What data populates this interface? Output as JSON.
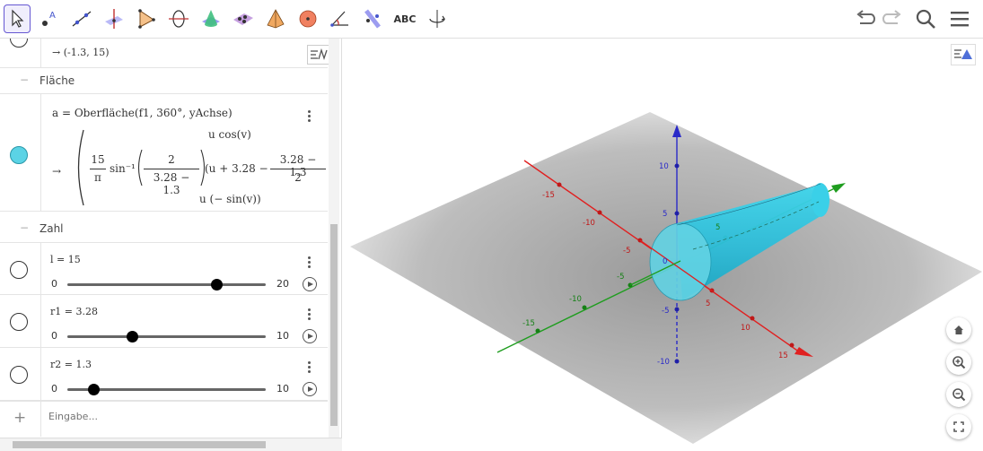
{
  "toolbar": {
    "tools": [
      {
        "name": "move-tool-icon"
      },
      {
        "name": "point-tool-icon"
      },
      {
        "name": "line-tool-icon"
      },
      {
        "name": "perpendicular-tool-icon"
      },
      {
        "name": "polygon-tool-icon"
      },
      {
        "name": "circle-axis-tool-icon"
      },
      {
        "name": "intersect-surfaces-tool-icon"
      },
      {
        "name": "plane-tool-icon"
      },
      {
        "name": "pyramid-tool-icon"
      },
      {
        "name": "sphere-tool-icon"
      },
      {
        "name": "angle-tool-icon"
      },
      {
        "name": "reflect-tool-icon"
      },
      {
        "name": "text-tool-icon"
      },
      {
        "name": "rotate-view-tool-icon"
      }
    ],
    "text_tool_label": "ABC"
  },
  "algebra": {
    "prev_output": "→  (-1.3, 15)",
    "group_surface": "Fläche",
    "surface_def": "a  =  Oberfläche(f1, 360°, yAchse)",
    "surface_output": {
      "arrow": "→",
      "frac15_num": "15",
      "frac15_den": "π",
      "asin": "sin⁻¹",
      "frac2_num": "2",
      "frac2_den": "3.28 − 1.3",
      "top_line": "u  cos(v)",
      "mid_line": "(u + 3.28 −",
      "frac3_num": "3.28 − 1.3",
      "frac3_den": "2",
      "bottom_line": "u (− sin(v))"
    },
    "group_number": "Zahl",
    "sliders": [
      {
        "label": "l = 15",
        "min": "0",
        "max": "20",
        "value": 15,
        "range": 20
      },
      {
        "label": "r1 = 3.28",
        "min": "0",
        "max": "10",
        "value": 3.28,
        "range": 10
      },
      {
        "label": "r2 = 1.3",
        "min": "0",
        "max": "10",
        "value": 1.3,
        "range": 10
      }
    ],
    "input_placeholder": "Eingabe..."
  },
  "axes": {
    "x_ticks": [
      "-15",
      "-10",
      "-5",
      "5",
      "10",
      "15"
    ],
    "y_ticks": [
      "-15",
      "-10",
      "-5",
      "5"
    ],
    "z_ticks": [
      "10",
      "5",
      "0",
      "-5",
      "-10"
    ],
    "colors": {
      "x": "#e02020",
      "y": "#1f9d1f",
      "z": "#2a2ac8",
      "surface": "#33c8e0"
    }
  }
}
